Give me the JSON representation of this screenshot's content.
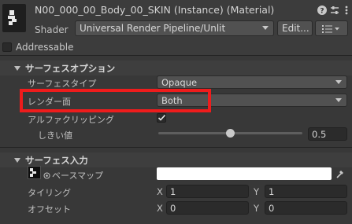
{
  "header": {
    "title": "N00_000_00_Body_00_SKIN (Instance) (Material)",
    "shader_label": "Shader",
    "shader_value": "Universal Render Pipeline/Unlit",
    "edit_label": "Edit...",
    "icons": [
      "help-icon",
      "settings-sliders-icon",
      "more-options-icon",
      "list-icon"
    ]
  },
  "addressable": {
    "label": "Addressable",
    "checked": false
  },
  "surface_options": {
    "title": "サーフェスオプション",
    "rows": [
      {
        "label": "サーフェスタイプ",
        "value": "Opaque"
      },
      {
        "label": "レンダー面",
        "value": "Both"
      },
      {
        "label": "アルファクリッピング",
        "checked": true
      },
      {
        "label": "しきい値",
        "value": "0.5",
        "slider_fraction": 0.5
      }
    ]
  },
  "surface_inputs": {
    "title": "サーフェス入力",
    "base_map_label": "ベースマップ",
    "base_color": "#ffffff",
    "tiling": {
      "label": "タイリング",
      "x_label": "X",
      "x": "1",
      "y_label": "Y",
      "y": "1"
    },
    "offset": {
      "label": "オフセット",
      "x_label": "X",
      "x": "0",
      "y_label": "Y",
      "y": "0"
    }
  },
  "highlight_color": "#ee1c1c"
}
